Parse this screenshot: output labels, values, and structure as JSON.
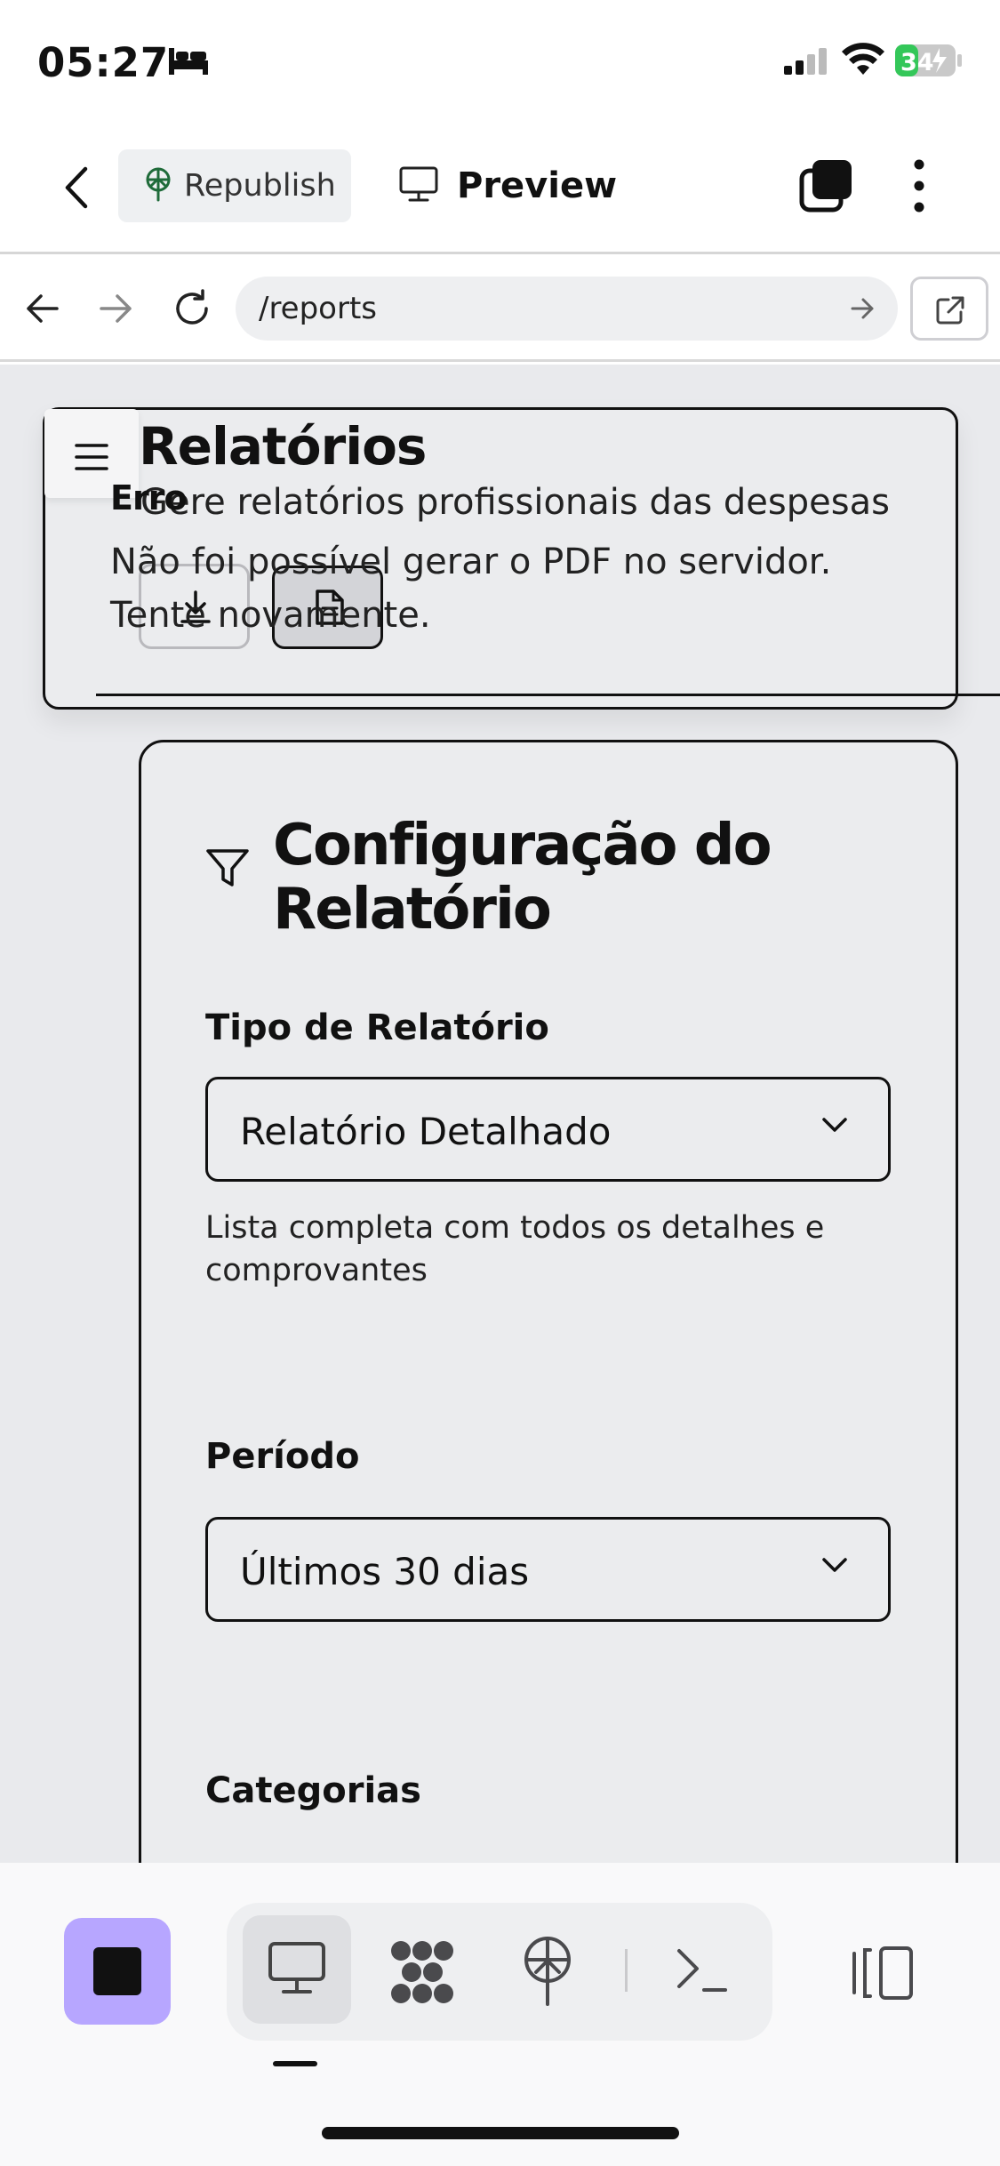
{
  "status": {
    "time": "05:27",
    "battery": "34"
  },
  "toolbar": {
    "republish_label": "Republish",
    "preview_label": "Preview"
  },
  "address": {
    "url": "/reports"
  },
  "header": {
    "title": "Relatórios",
    "subtitle": "Gere relatórios profissionais das despesas"
  },
  "error": {
    "title": "Erro",
    "message": "Não foi possível gerar o PDF no servidor. Tente novamente."
  },
  "config": {
    "title": "Configuração do Relatório",
    "report_type_label": "Tipo de Relatório",
    "report_type_value": "Relatório Detalhado",
    "report_type_help": "Lista completa com todos os detalhes e comprovantes",
    "period_label": "Período",
    "period_value": "Últimos 30 dias",
    "categories_label": "Categorias"
  },
  "colors": {
    "accent": "#b7a6ff",
    "battery_green": "#34c759",
    "republish_icon": "#1f6b3a"
  }
}
